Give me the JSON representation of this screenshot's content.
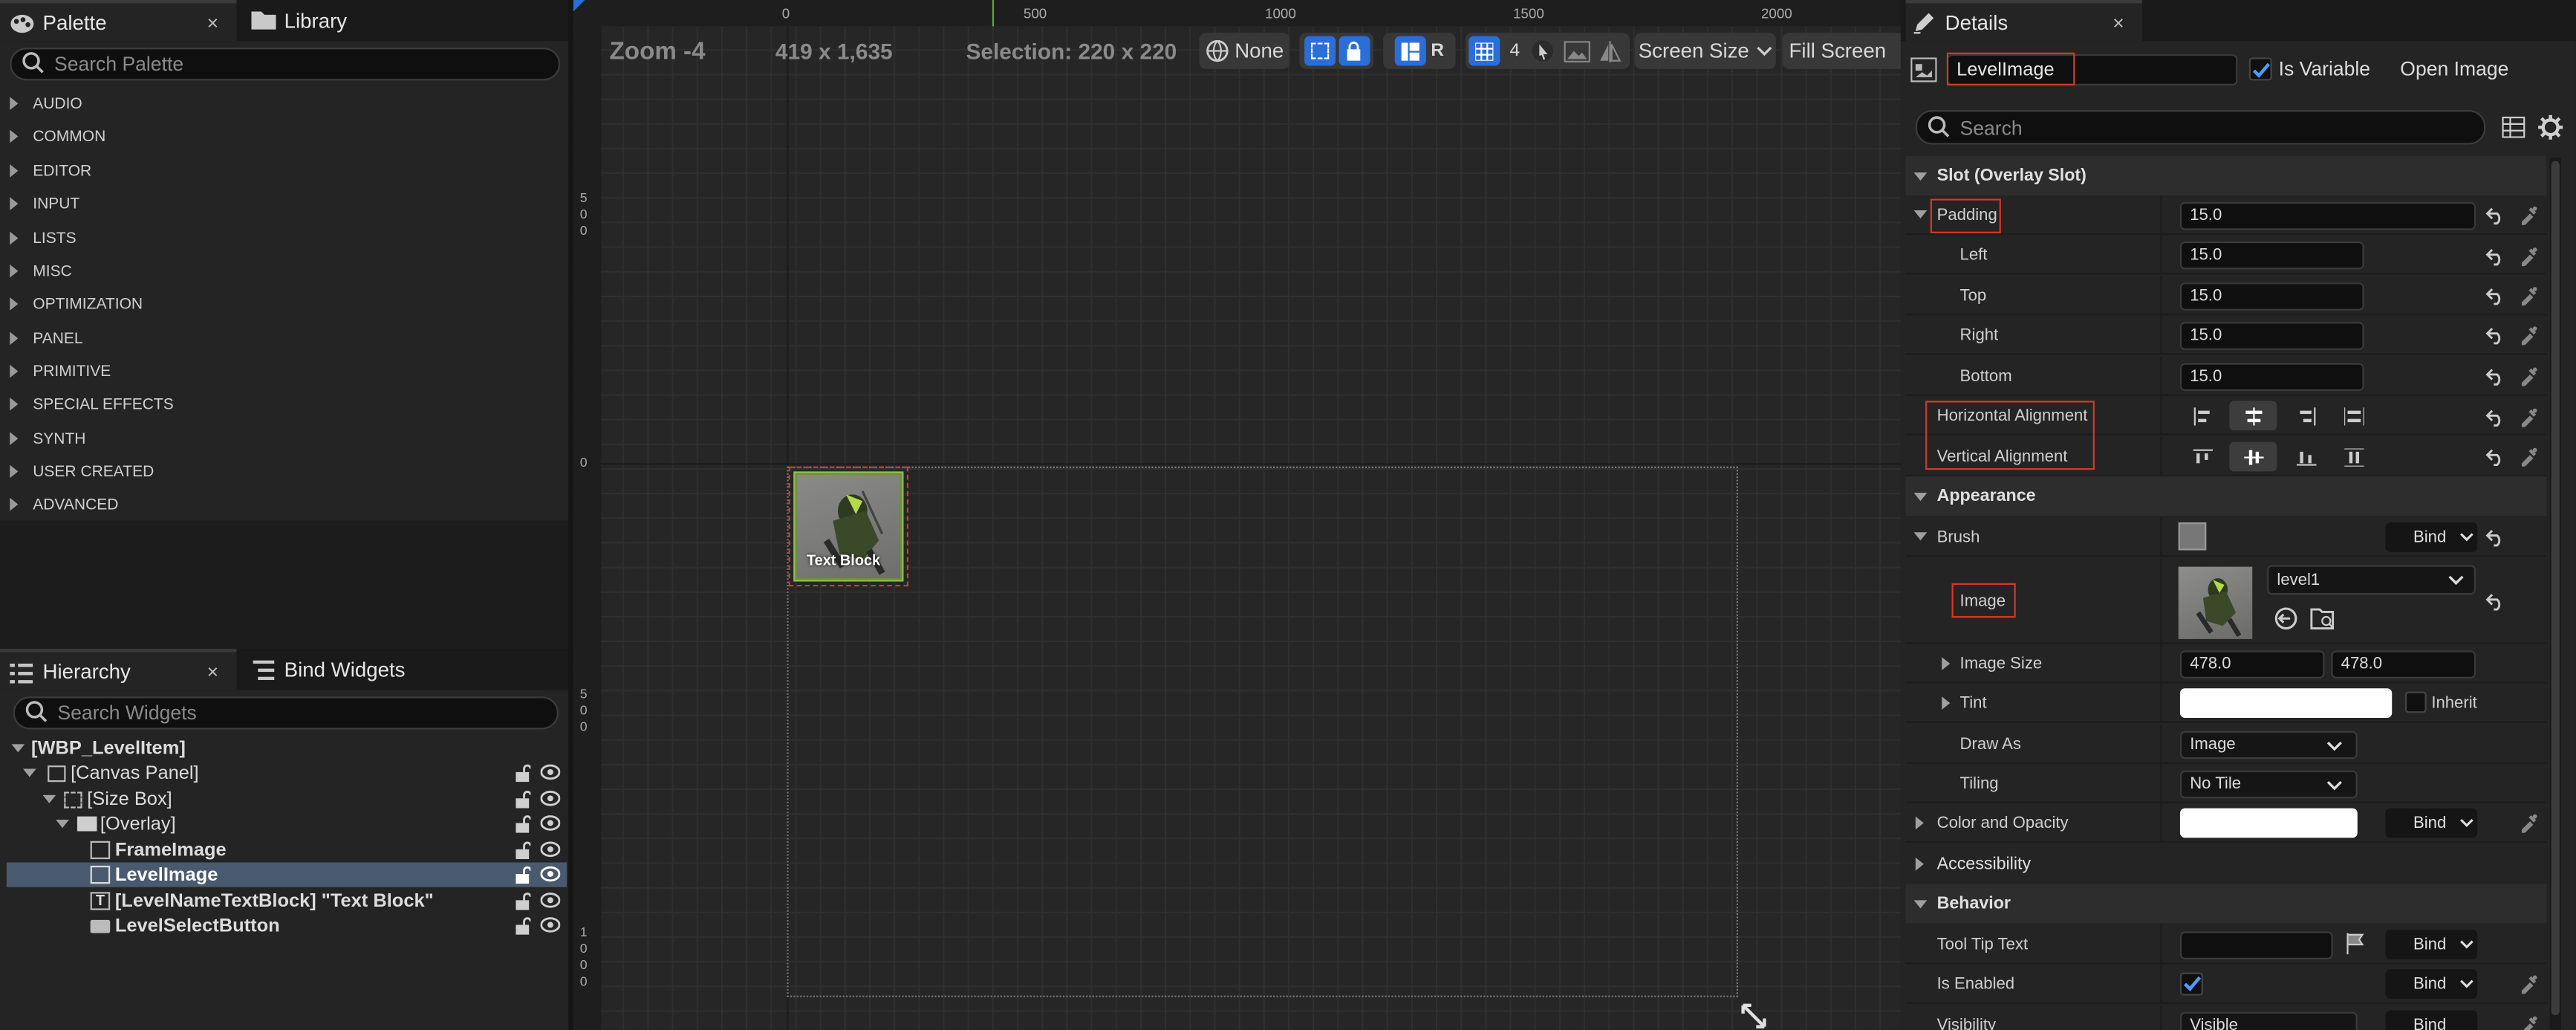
{
  "palette": {
    "tab_label": "Palette",
    "library_label": "Library",
    "close": "×",
    "search_placeholder": "Search Palette",
    "categories": [
      "AUDIO",
      "COMMON",
      "EDITOR",
      "INPUT",
      "LISTS",
      "MISC",
      "OPTIMIZATION",
      "PANEL",
      "PRIMITIVE",
      "SPECIAL EFFECTS",
      "SYNTH",
      "USER CREATED",
      "ADVANCED"
    ]
  },
  "hierarchy": {
    "tab_label": "Hierarchy",
    "bind_label": "Bind Widgets",
    "close": "×",
    "search_placeholder": "Search Widgets",
    "items": [
      "[WBP_LevelItem]",
      "[Canvas Panel]",
      "[Size Box]",
      "[Overlay]",
      "FrameImage",
      "LevelImage",
      "[LevelNameTextBlock] \"Text Block\"",
      "LevelSelectButton"
    ]
  },
  "toolbar": {
    "zoom": "Zoom -4",
    "resolution": "419 x 1,635",
    "selection": "Selection: 220 x 220",
    "none": "None",
    "r": "R",
    "grid_num": "4",
    "screen_size": "Screen Size",
    "fill_screen": "Fill Screen"
  },
  "rulers": {
    "h": [
      "0",
      "500",
      "1000",
      "1500",
      "2000"
    ],
    "v_500": [
      "5",
      "0",
      "0"
    ],
    "v_0": "0",
    "v_5002": [
      "5",
      "0",
      "0"
    ],
    "v_1000": [
      "1",
      "0",
      "0",
      "0"
    ]
  },
  "widget": {
    "text_block": "Text Block"
  },
  "details": {
    "tab_label": "Details",
    "close": "×",
    "name": "LevelImage",
    "is_variable": "Is Variable",
    "open_image": "Open Image",
    "search_placeholder": "Search",
    "slot_section": "Slot (Overlay Slot)",
    "padding": "Padding",
    "padding_value": "15.0",
    "left": "Left",
    "top": "Top",
    "right": "Right",
    "bottom": "Bottom",
    "left_value": "15.0",
    "top_value": "15.0",
    "right_value": "15.0",
    "bottom_value": "15.0",
    "h_align": "Horizontal Alignment",
    "v_align": "Vertical Alignment",
    "appearance": "Appearance",
    "brush": "Brush",
    "bind": "Bind",
    "image": "Image",
    "image_asset": "level1",
    "image_size": "Image Size",
    "image_size_x": "478.0",
    "image_size_y": "478.0",
    "tint": "Tint",
    "inherit": "Inherit",
    "draw_as": "Draw As",
    "draw_as_value": "Image",
    "tiling": "Tiling",
    "tiling_value": "No Tile",
    "color_opacity": "Color and Opacity",
    "accessibility": "Accessibility",
    "behavior": "Behavior",
    "tooltip": "Tool Tip Text",
    "is_enabled": "Is Enabled",
    "visibility": "Visibility",
    "visibility_value": "Visible"
  },
  "colors": {
    "accent_blue": "#2a6fd8",
    "highlight_red": "#d23a28",
    "selection_row": "#4a5a6e"
  }
}
